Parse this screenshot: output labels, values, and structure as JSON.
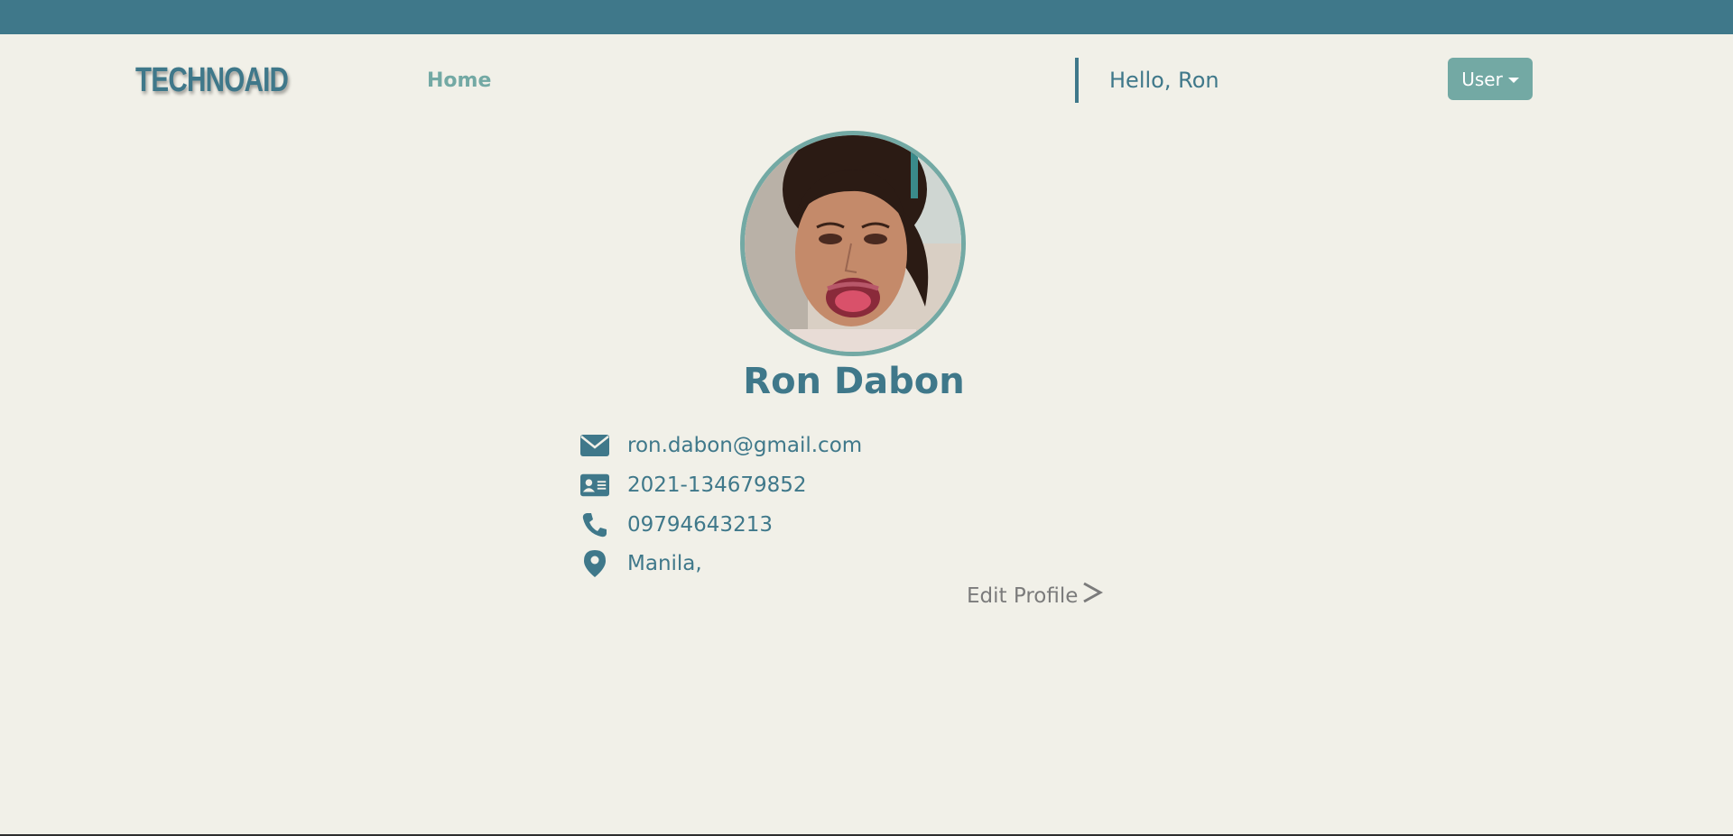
{
  "header": {
    "logo": "TECHNOAID",
    "nav_home": "Home",
    "greeting": "Hello, Ron",
    "user_menu_label": "User"
  },
  "profile": {
    "name": "Ron Dabon",
    "email": "ron.dabon@gmail.com",
    "id_number": "2021-134679852",
    "phone": "09794643213",
    "location": "Manila,",
    "edit_label": "Edit Profile",
    "icons": {
      "email": "envelope-icon",
      "id": "id-card-icon",
      "phone": "phone-icon",
      "location": "map-pin-icon",
      "edit": "chevron-right-icon"
    }
  },
  "colors": {
    "primary": "#3f788a",
    "accent": "#73a9a4",
    "background": "#f1f0e8",
    "muted": "#7b7b7b"
  }
}
